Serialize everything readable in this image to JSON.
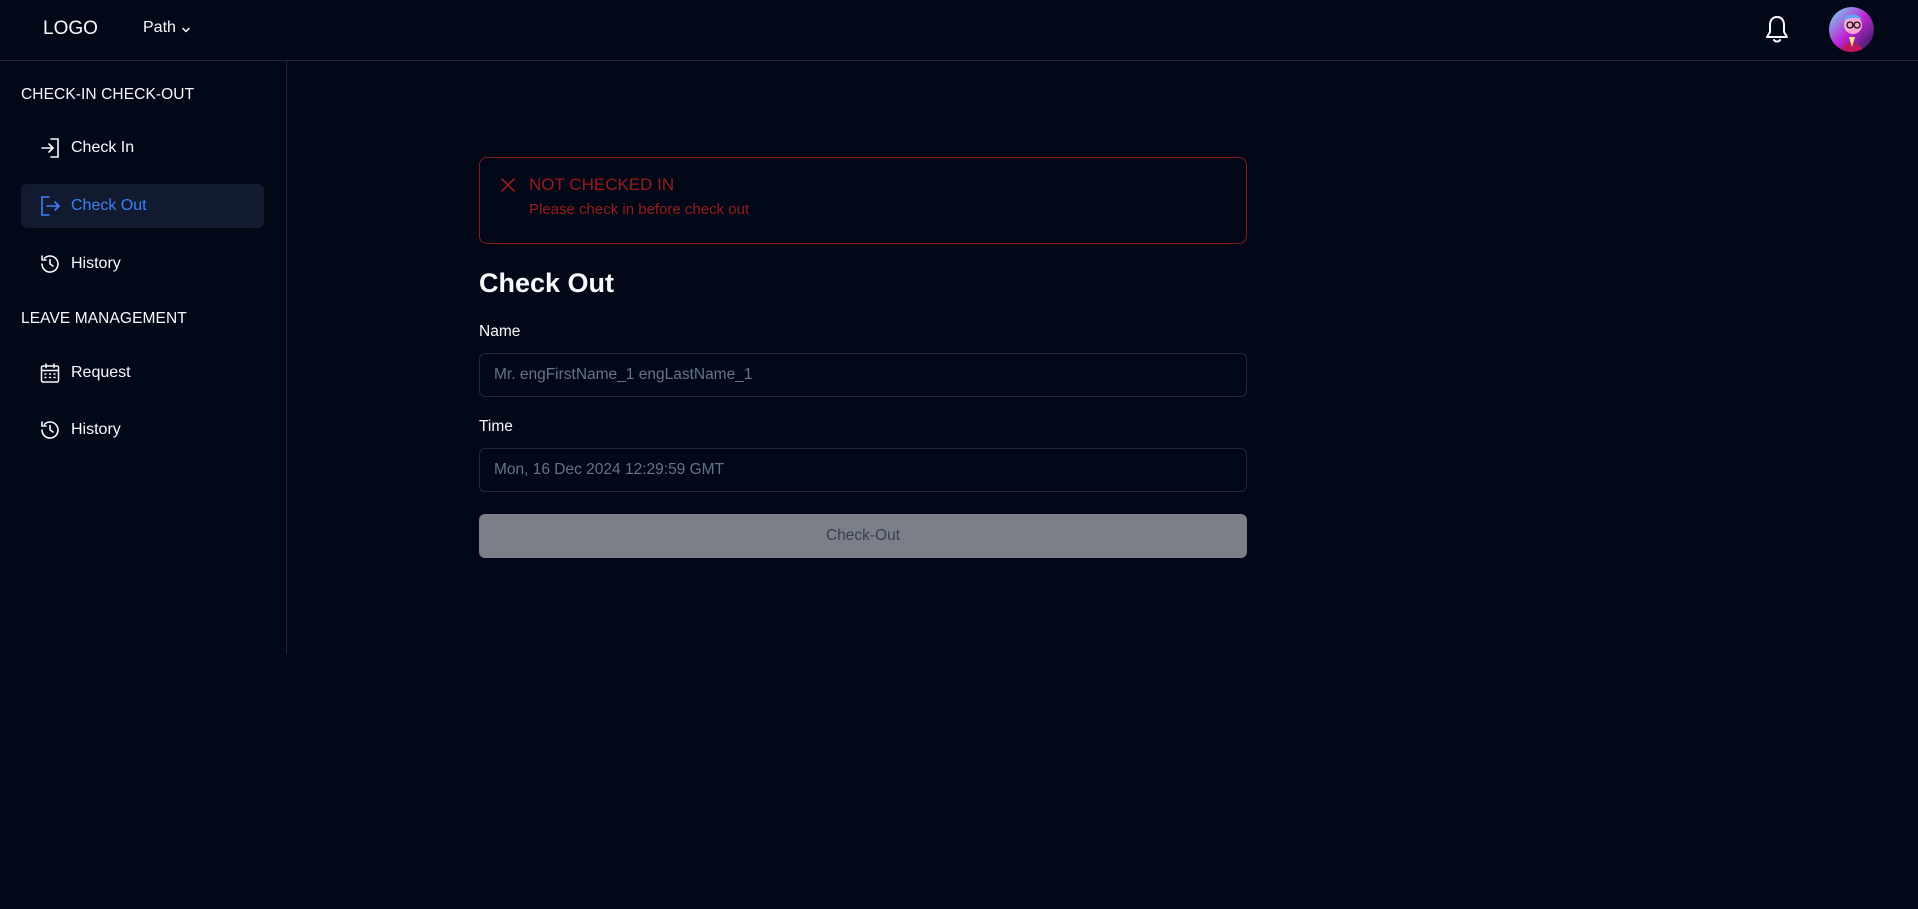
{
  "header": {
    "logo": "LOGO",
    "path_label": "Path",
    "bell_icon": "bell-icon",
    "avatar_icon": "user-avatar"
  },
  "sidebar": {
    "sections": [
      {
        "title": "CHECK-IN CHECK-OUT",
        "items": [
          {
            "label": "Check In",
            "icon": "check-in-icon",
            "active": false
          },
          {
            "label": "Check Out",
            "icon": "check-out-icon",
            "active": true
          },
          {
            "label": "History",
            "icon": "history-icon",
            "active": false
          }
        ]
      },
      {
        "title": "LEAVE MANAGEMENT",
        "items": [
          {
            "label": "Request",
            "icon": "calendar-icon",
            "active": false
          },
          {
            "label": "History",
            "icon": "history-icon",
            "active": false
          }
        ]
      }
    ]
  },
  "alert": {
    "icon": "close-icon",
    "title": "NOT CHECKED IN",
    "description": "Please check in before check out"
  },
  "form": {
    "title": "Check Out",
    "name_label": "Name",
    "name_placeholder": "Mr. engFirstName_1 engLastName_1",
    "time_label": "Time",
    "time_placeholder": "Mon, 16 Dec 2024 12:29:59 GMT",
    "submit_label": "Check-Out"
  },
  "colors": {
    "background": "#020817",
    "border": "#1e293b",
    "active_item_bg": "#111a2e",
    "active_item_text": "#3b82f6",
    "alert_red": "#991b1b",
    "button_disabled_bg": "#7c7f88"
  }
}
